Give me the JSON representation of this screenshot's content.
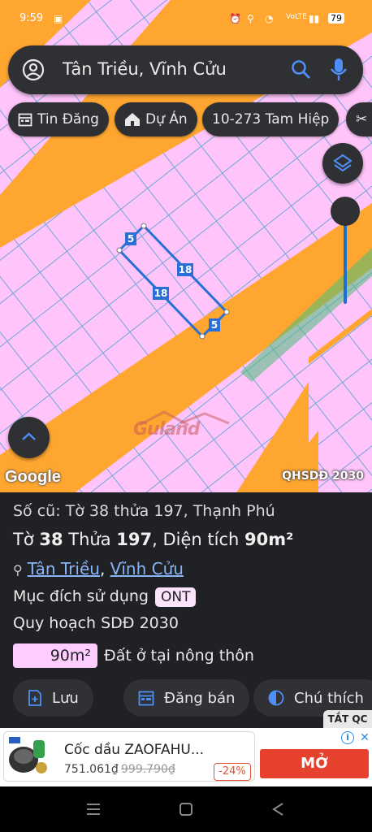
{
  "status": {
    "time": "9:59",
    "battery": "79"
  },
  "search": {
    "query": "Tân Triều, Vĩnh Cửu"
  },
  "chips": [
    {
      "icon": "calendar-icon",
      "label": "Tin Đăng"
    },
    {
      "icon": "home-icon",
      "label": "Dự Án"
    },
    {
      "icon": "",
      "label": "10-273 Tam Hiệp"
    }
  ],
  "map": {
    "parcel_edges": [
      "5",
      "18",
      "18",
      "5"
    ],
    "google_label": "Google",
    "layer_label": "QHSDĐ 2030",
    "watermark": "Guland",
    "colors": {
      "land": "#ffc4fa",
      "road": "#ffa630",
      "grid": "#6fa8d8",
      "parcel": "#2a6fd6"
    }
  },
  "sheet": {
    "old_info": "Số cũ: Tờ 38 thửa 197, Thạnh Phú",
    "sheet_label": "Tờ ",
    "sheet_no": "38",
    "plot_label": " Thửa ",
    "plot_no": "197",
    "area_label": ", Diện tích ",
    "area": "90m²",
    "ward": "Tân Triều",
    "district": "Vĩnh Cửu",
    "purpose_label": "Mục đích sử dụng",
    "purpose_code": "ONT",
    "plan_label": "Quy hoạch SDĐ 2030",
    "plan_area": "90m²",
    "plan_desc": "Đất ở tại nông thôn",
    "buttons": {
      "save": "Lưu",
      "sell": "Đăng bán",
      "legend": "Chú thích"
    }
  },
  "ad": {
    "label": "TẮT QC",
    "title": "Cốc dầu ZAOFAHU...",
    "price": "751.061₫",
    "old_price": "999.790₫",
    "discount": "-24%",
    "cta": "MỞ"
  }
}
